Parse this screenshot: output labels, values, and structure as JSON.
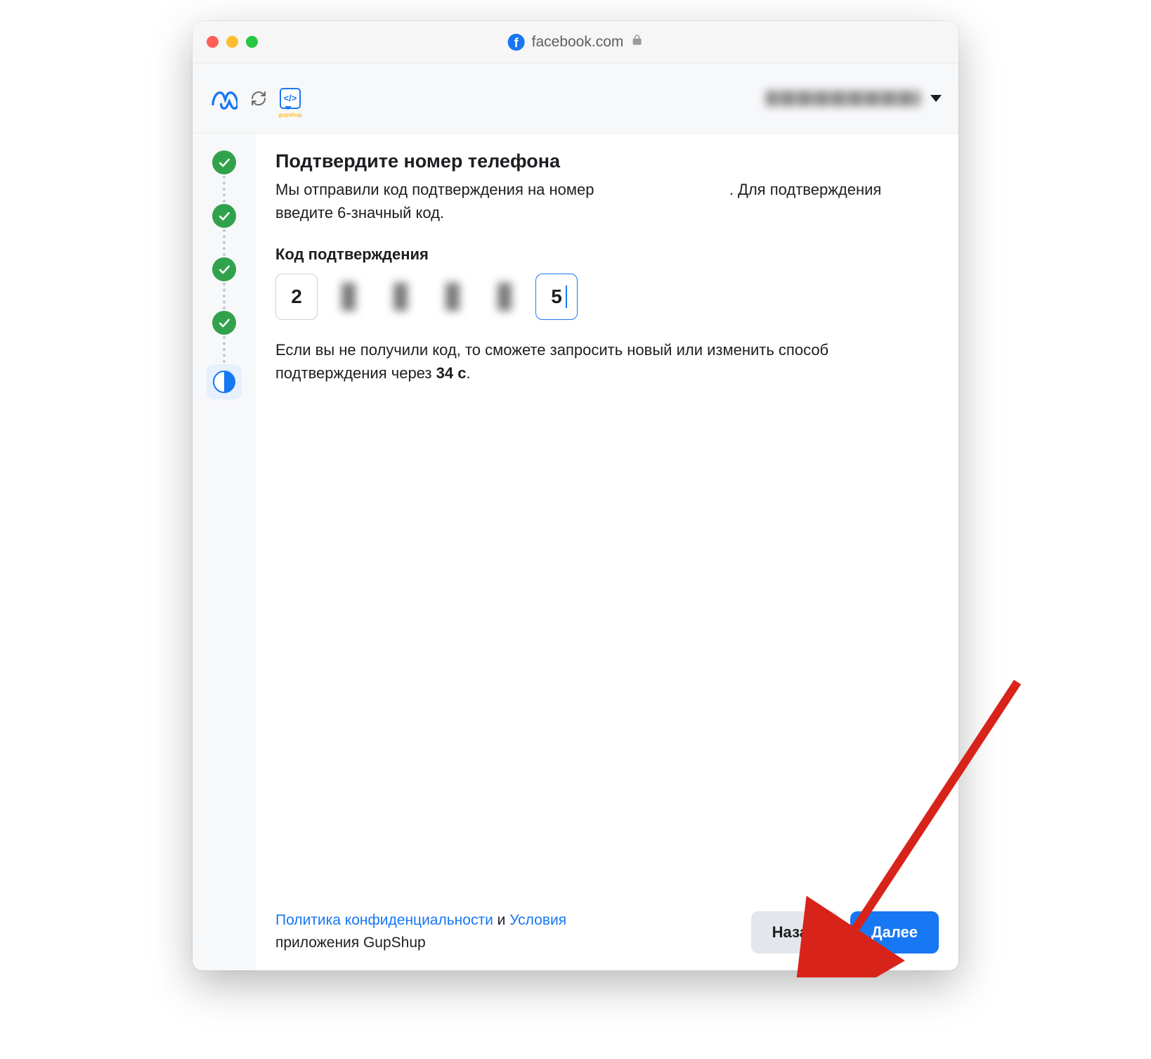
{
  "browser": {
    "domain": "facebook.com"
  },
  "header": {
    "gupshup_label": "</>"
  },
  "steps": {
    "completed_count": 4,
    "current_index": 5
  },
  "main": {
    "title": "Подтвердите номер телефона",
    "subtitle_pre": "Мы отправили код подтверждения на номер ",
    "subtitle_post": ". Для подтверждения введите 6-значный код.",
    "code_label": "Код подтверждения",
    "code_digits": [
      "2",
      "",
      "",
      "",
      "",
      "5"
    ],
    "retry_pre": "Если вы не получили код, то сможете запросить новый или изменить способ подтверждения через ",
    "retry_countdown": "34 с",
    "retry_post": "."
  },
  "footer": {
    "privacy_link": "Политика конфиденциальности",
    "and_word": " и ",
    "terms_link": "Условия",
    "app_line": "приложения GupShup",
    "back_label": "Назад",
    "next_label": "Далее"
  }
}
